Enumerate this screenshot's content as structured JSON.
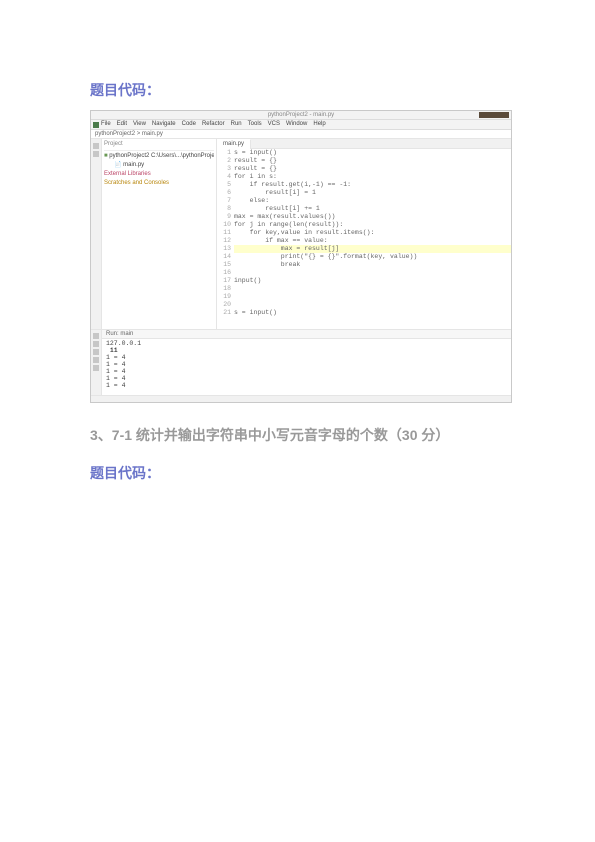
{
  "heading1": "题目代码：",
  "ide": {
    "title": "pythonProject2 - main.py",
    "menu": [
      "File",
      "Edit",
      "View",
      "Navigate",
      "Code",
      "Refactor",
      "Run",
      "Tools",
      "VCS",
      "Window",
      "Help"
    ],
    "breadcrumb": "pythonProject2 > main.py",
    "tree_hdr": "Project",
    "tree_items": [
      "pythonProject2  C:\\Users\\...\\pythonProject2",
      "  main.py",
      "External Libraries",
      "Scratches and Consoles"
    ],
    "tab": "main.py",
    "code_lines": [
      "s = input()",
      "result = {}",
      "result = {}",
      "for i in s:",
      "    if result.get(i,-1) == -1:",
      "        result[i] = 1",
      "    else:",
      "        result[i] += 1",
      "max = max(result.values())",
      "for j in range(len(result)):",
      "    for key,value in result.items():",
      "        if max == value:",
      "            max = result[j]",
      "            print(\"{} = {}\".format(key, value))",
      "            break",
      "",
      "input()",
      "",
      "",
      "",
      "s = input()"
    ],
    "console_tab": "Run: main",
    "console_lines": [
      "127.0.0.1",
      " 11",
      "1 = 4",
      "1 = 4",
      "1 = 4",
      "1 = 4",
      "1 = 4"
    ]
  },
  "question3": "3、7-1 统计并输出字符串中小写元音字母的个数（30 分）",
  "heading2": "题目代码："
}
